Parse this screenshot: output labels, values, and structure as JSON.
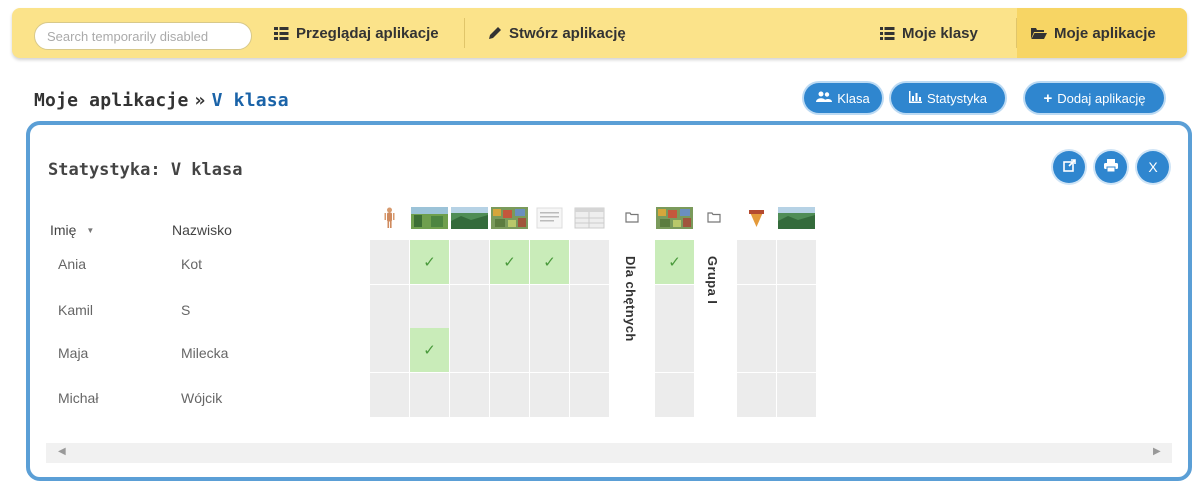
{
  "nav": {
    "search_placeholder": "Search temporarily disabled",
    "browse_label": "Przeglądaj aplikacje",
    "create_label": "Stwórz aplikację",
    "classes_label": "Moje klasy",
    "apps_label": "Moje aplikacje"
  },
  "breadcrumb": {
    "root": "Moje aplikacje",
    "separator": "»",
    "current": "V klasa"
  },
  "actions": {
    "class_label": "Klasa",
    "stats_label": "Statystyka",
    "add_label": "Dodaj aplikację"
  },
  "panel": {
    "title": "Statystyka: V klasa"
  },
  "table": {
    "first_name_header": "Imię",
    "sort_indicator": "▼",
    "last_name_header": "Nazwisko",
    "rows": [
      {
        "first": "Ania",
        "last": "Kot"
      },
      {
        "first": "Kamil",
        "last": "S"
      },
      {
        "first": "Maja",
        "last": "Milecka"
      },
      {
        "first": "Michał",
        "last": "Wójcik"
      }
    ],
    "folder_labels": [
      "Dla chętnych",
      "Grupa I"
    ],
    "checkmark": "✓",
    "completion": [
      [
        false,
        true,
        false,
        true,
        true,
        false,
        true,
        false,
        false
      ],
      [
        false,
        false,
        false,
        false,
        false,
        false,
        false,
        false,
        false
      ],
      [
        false,
        true,
        false,
        false,
        false,
        false,
        false,
        false,
        false
      ],
      [
        false,
        false,
        false,
        false,
        false,
        false,
        false,
        false,
        false
      ]
    ]
  },
  "colors": {
    "nav_bg": "#fbe38a",
    "accent": "#2f86cf",
    "panel_border": "#5b9fd6",
    "done_cell": "#c9ecb9",
    "empty_cell": "#ececec"
  },
  "icons": {
    "browse": "grid-icon",
    "create": "pencil-icon",
    "classes": "list-icon",
    "apps": "folder-open-icon",
    "class": "users-icon",
    "stats": "bar-chart-icon",
    "add": "plus-icon",
    "open": "external-link-icon",
    "print": "print-icon",
    "close": "close-icon",
    "folder": "folder-icon"
  }
}
